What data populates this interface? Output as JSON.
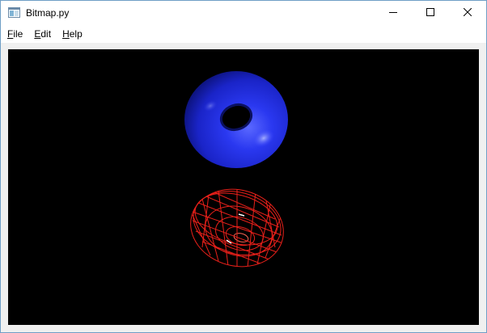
{
  "window": {
    "title": "Bitmap.py"
  },
  "icons": {
    "app": "app-window-icon",
    "minimize": "minimize-icon",
    "maximize": "maximize-icon",
    "close": "close-icon"
  },
  "menu": {
    "items": [
      {
        "mnemonic": "F",
        "rest": "ile"
      },
      {
        "mnemonic": "E",
        "rest": "dit"
      },
      {
        "mnemonic": "H",
        "rest": "elp"
      }
    ]
  },
  "scene": {
    "background": "#000000",
    "solid_torus_color": "#1d2be8",
    "wire_torus_color": "#e8201a"
  }
}
